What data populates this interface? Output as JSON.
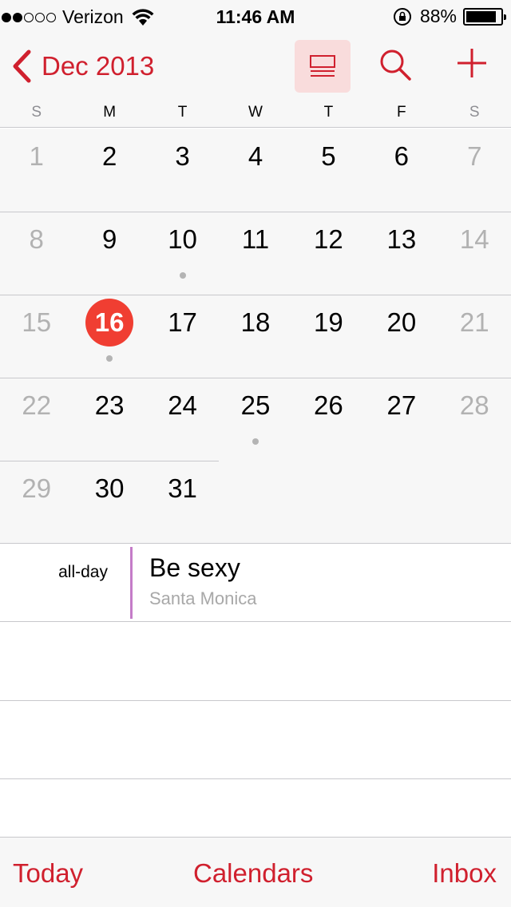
{
  "status_bar": {
    "carrier": "Verizon",
    "time": "11:46 AM",
    "battery_percent": "88%",
    "battery_level": 0.88,
    "signal_bars_filled": 2,
    "signal_bars_total": 5
  },
  "nav": {
    "back_label": "Dec 2013",
    "accent_color": "#d0202e",
    "icons": [
      "chevron-left-icon",
      "list-view-icon",
      "search-icon",
      "plus-icon"
    ]
  },
  "weekdays": [
    "S",
    "M",
    "T",
    "W",
    "T",
    "F",
    "S"
  ],
  "month": {
    "weeks": [
      [
        "1",
        "2",
        "3",
        "4",
        "5",
        "6",
        "7"
      ],
      [
        "8",
        "9",
        "10",
        "11",
        "12",
        "13",
        "14"
      ],
      [
        "15",
        "16",
        "17",
        "18",
        "19",
        "20",
        "21"
      ],
      [
        "22",
        "23",
        "24",
        "25",
        "26",
        "27",
        "28"
      ],
      [
        "29",
        "30",
        "31",
        "",
        "",
        "",
        ""
      ]
    ],
    "today": "16",
    "today_color": "#f03e32",
    "event_days": [
      "10",
      "16",
      "25"
    ]
  },
  "events": [
    {
      "time_label": "all-day",
      "title": "Be sexy",
      "location": "Santa Monica",
      "calendar_color": "#c47cc8"
    }
  ],
  "toolbar": {
    "today_label": "Today",
    "calendars_label": "Calendars",
    "inbox_label": "Inbox"
  }
}
